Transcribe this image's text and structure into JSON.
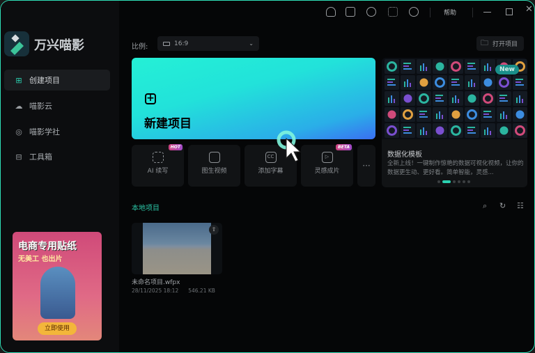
{
  "app": {
    "name": "万兴喵影"
  },
  "sidebar": {
    "items": [
      {
        "label": "创建项目",
        "icon": "new-file-icon",
        "active": true
      },
      {
        "label": "喵影云",
        "icon": "cloud-icon"
      },
      {
        "label": "喵影学社",
        "icon": "lightbulb-icon"
      },
      {
        "label": "工具箱",
        "icon": "toolbox-icon"
      }
    ],
    "banner": {
      "title": "电商专用贴纸",
      "subtitle": "无美工 也出片",
      "button": "立即使用"
    }
  },
  "titlebar": {
    "help": "帮助",
    "icons": [
      "user-icon",
      "task-icon",
      "cloud-upload-icon",
      "apps-icon",
      "headset-icon"
    ]
  },
  "toolbar": {
    "ratio_label": "比例:",
    "ratio_value": "16:9",
    "open_project": "打开项目"
  },
  "hero": {
    "title": "新建项目"
  },
  "tools": [
    {
      "label": "AI 续写",
      "badge": "HOT"
    },
    {
      "label": "图生视频"
    },
    {
      "label": "添加字幕"
    },
    {
      "label": "灵感成片",
      "badge": "BETA"
    }
  ],
  "template": {
    "badge": "New",
    "title": "数据化模板",
    "desc": "全新上线！一键制作惊艳的数据可视化视频，让你的数据更生动、更好看。简单智能，灵感...",
    "pages": 6,
    "current_page": 2
  },
  "local": {
    "title": "本地项目",
    "projects": [
      {
        "name": "未命名项目.wfpx",
        "date": "28/11/2025 18:12",
        "size": "546.21 KB"
      }
    ]
  },
  "colors": {
    "accent": "#2bd1b0",
    "border": "#2fe0b8"
  }
}
